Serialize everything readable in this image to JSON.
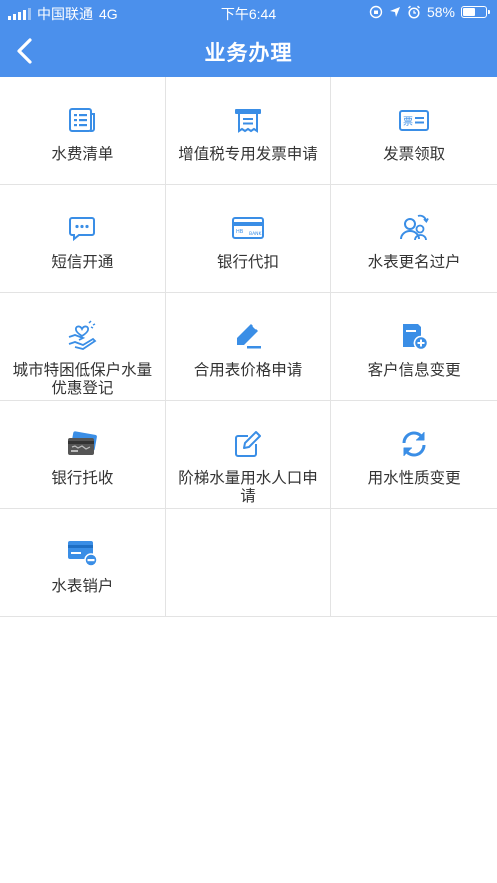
{
  "status_bar": {
    "carrier": "中国联通",
    "network": "4G",
    "time": "下午6:44",
    "battery": "58%",
    "battery_level": 0.58
  },
  "header": {
    "title": "业务办理",
    "back_icon": "chevron-left-icon"
  },
  "colors": {
    "header_bg": "#4b90ec",
    "icon_blue": "#3a8ee6"
  },
  "services": [
    {
      "label": "水费清单",
      "icon": "bill-list-icon"
    },
    {
      "label": "增值税专用发票申请",
      "icon": "invoice-receipt-icon"
    },
    {
      "label": "发票领取",
      "icon": "ticket-card-icon"
    },
    {
      "label": "短信开通",
      "icon": "sms-chat-icon"
    },
    {
      "label": "银行代扣",
      "icon": "bank-card-icon"
    },
    {
      "label": "水表更名过户",
      "icon": "user-transfer-icon"
    },
    {
      "label": "城市特困低保户水量优惠登记",
      "icon": "hand-heart-icon"
    },
    {
      "label": "合用表价格申请",
      "icon": "pen-edit-icon"
    },
    {
      "label": "客户信息变更",
      "icon": "info-change-icon"
    },
    {
      "label": "银行托收",
      "icon": "bank-cards-icon"
    },
    {
      "label": "阶梯水量用水人口申请",
      "icon": "edit-form-icon"
    },
    {
      "label": "用水性质变更",
      "icon": "refresh-icon"
    },
    {
      "label": "水表销户",
      "icon": "card-cancel-icon"
    }
  ]
}
